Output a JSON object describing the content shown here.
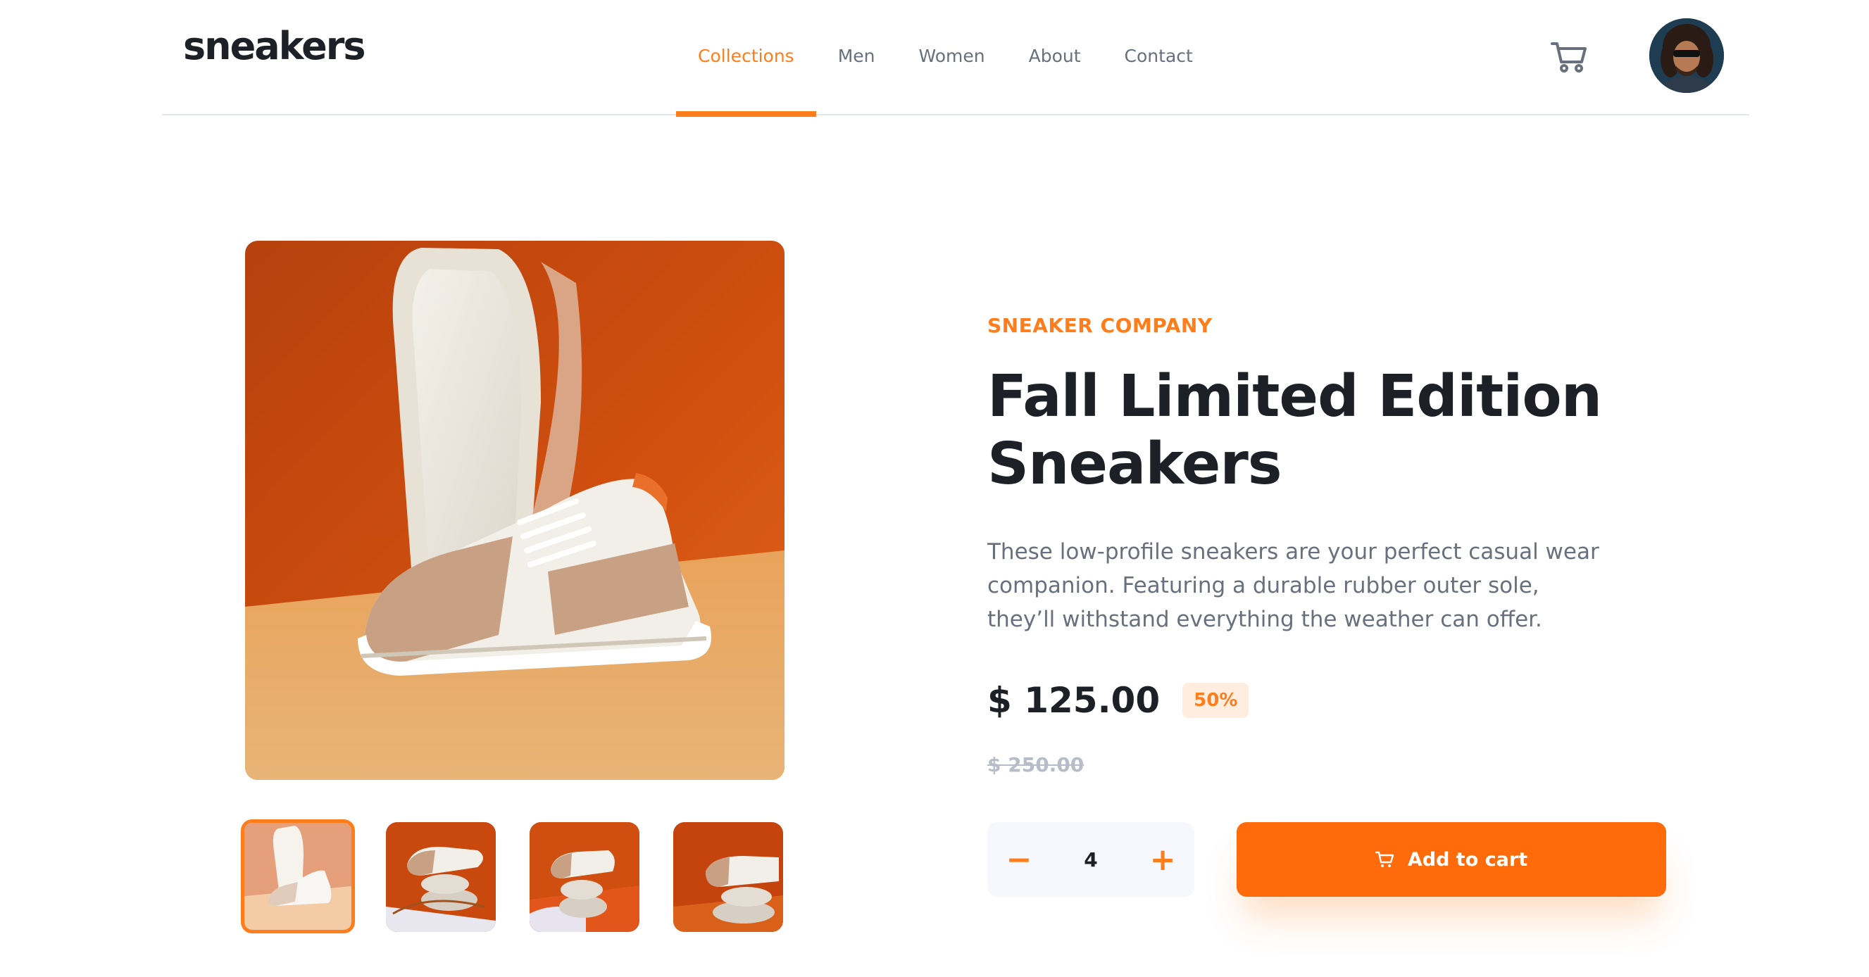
{
  "brand": {
    "logo_text": "sneakers"
  },
  "nav": {
    "items": [
      {
        "label": "Collections",
        "active": true
      },
      {
        "label": "Men",
        "active": false
      },
      {
        "label": "Women",
        "active": false
      },
      {
        "label": "About",
        "active": false
      },
      {
        "label": "Contact",
        "active": false
      }
    ]
  },
  "header": {
    "cart_icon": "cart-icon",
    "avatar_icon": "user-avatar"
  },
  "gallery": {
    "main_image": "sneaker-product-photo-1",
    "thumbnails": [
      {
        "name": "thumbnail-1",
        "selected": true
      },
      {
        "name": "thumbnail-2",
        "selected": false
      },
      {
        "name": "thumbnail-3",
        "selected": false
      },
      {
        "name": "thumbnail-4",
        "selected": false
      }
    ]
  },
  "product": {
    "company": "SNEAKER COMPANY",
    "title_line1": "Fall Limited Edition",
    "title_line2": "Sneakers",
    "description": "These low-profile sneakers are your perfect casual wear companion. Featuring a durable rubber outer sole, they’ll withstand everything the weather can offer.",
    "price": "$ 125.00",
    "discount": "50%",
    "original_price": "$ 250.00"
  },
  "cart_controls": {
    "minus_label": "−",
    "quantity": "4",
    "plus_label": "+",
    "add_label": "Add to cart"
  },
  "colors": {
    "accent": "#ff7e1b",
    "button": "#ff6a0b",
    "text_dark": "#1d2026",
    "text_gray": "#69707d",
    "badge_bg": "#ffede0",
    "qty_bg": "#f6f8fd"
  }
}
